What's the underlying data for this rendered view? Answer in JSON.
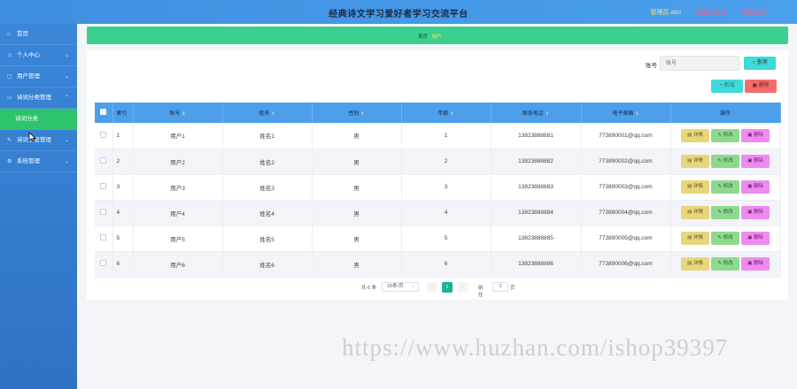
{
  "header": {
    "title": "经典诗文学习爱好者学习交流平台",
    "admin": "管理员 abo",
    "front_link": "退出到前台",
    "logout_link": "退出登录"
  },
  "sidebar": {
    "items": [
      {
        "label": "首页",
        "icon": "home-icon"
      },
      {
        "label": "个人中心",
        "icon": "user-icon"
      },
      {
        "label": "用户管理",
        "icon": "users-icon"
      },
      {
        "label": "诗词分类管理",
        "icon": "folder-icon"
      },
      {
        "label": "诗词分类",
        "icon": ""
      },
      {
        "label": "诗词信息管理",
        "icon": "book-icon"
      },
      {
        "label": "系统管理",
        "icon": "settings-icon"
      }
    ]
  },
  "breadcrumb": {
    "home": "首页",
    "current": "用户"
  },
  "search": {
    "label": "账号",
    "placeholder": "账号",
    "button": "查询"
  },
  "actions": {
    "add": "新增",
    "delete": "删除"
  },
  "table": {
    "columns": [
      "",
      "索引",
      "账号",
      "姓名",
      "性别",
      "年龄",
      "联系电话",
      "电子邮箱",
      "操作"
    ],
    "rows": [
      {
        "index": "1",
        "account": "用户1",
        "name": "姓名1",
        "gender": "男",
        "age": "1",
        "phone": "13823888881",
        "email": "773890001@qq.com"
      },
      {
        "index": "2",
        "account": "用户2",
        "name": "姓名2",
        "gender": "男",
        "age": "2",
        "phone": "13823888882",
        "email": "773890002@qq.com"
      },
      {
        "index": "3",
        "account": "用户3",
        "name": "姓名3",
        "gender": "男",
        "age": "3",
        "phone": "13823888883",
        "email": "773890003@qq.com"
      },
      {
        "index": "4",
        "account": "用户4",
        "name": "姓名4",
        "gender": "男",
        "age": "4",
        "phone": "13823888884",
        "email": "773890004@qq.com"
      },
      {
        "index": "5",
        "account": "用户5",
        "name": "姓名5",
        "gender": "男",
        "age": "5",
        "phone": "13823888885",
        "email": "773890005@qq.com"
      },
      {
        "index": "6",
        "account": "用户6",
        "name": "姓名6",
        "gender": "男",
        "age": "6",
        "phone": "13823888886",
        "email": "773890006@qq.com"
      }
    ],
    "row_buttons": {
      "detail": "详情",
      "edit": "修改",
      "remove": "删除"
    }
  },
  "pagination": {
    "total": "共 6 条",
    "page_size": "10条/页",
    "current": "1",
    "goto_label": "前往",
    "goto_value": "1",
    "page_suffix": "页"
  },
  "watermark": "https://www.huzhan.com/ishop39397",
  "colors": {
    "header": "#4aa0ec",
    "sidebar": "#3a86d9",
    "active": "#2ec46d",
    "crumb": "#3bd08f",
    "table_head": "#4d9fea"
  }
}
